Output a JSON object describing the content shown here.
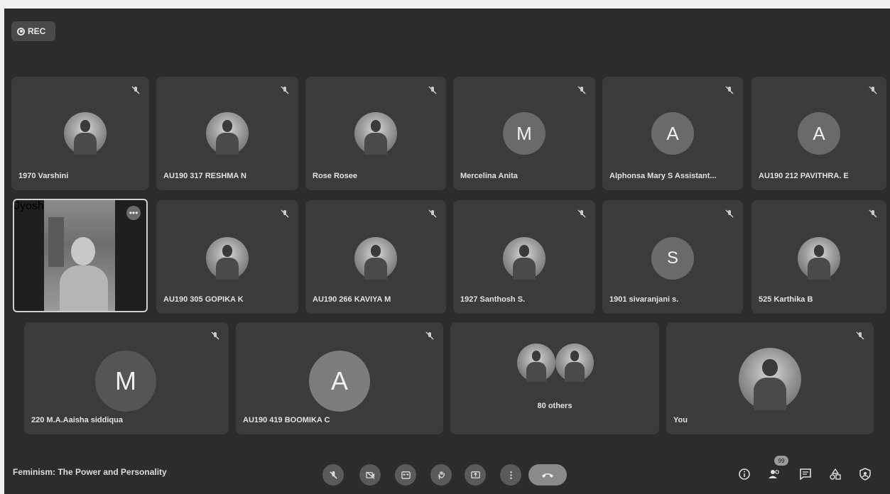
{
  "recording": {
    "label": "REC"
  },
  "participants": [
    {
      "name": "1970 Varshini",
      "avatar": "photo"
    },
    {
      "name": "AU190 317 RESHMA N",
      "avatar": "photo"
    },
    {
      "name": "Rose Rosee",
      "avatar": "photo"
    },
    {
      "name": "Mercelina Anita",
      "avatar": "letter",
      "initial": "M"
    },
    {
      "name": "Alphonsa Mary S Assistant...",
      "avatar": "letter",
      "initial": "A"
    },
    {
      "name": "AU190 212 PAVITHRA. E",
      "avatar": "letter",
      "initial": "A"
    },
    {
      "name": "Jyoshna Vijayan",
      "avatar": "video"
    },
    {
      "name": "AU190 305 GOPIKA K",
      "avatar": "photo"
    },
    {
      "name": "AU190 266 KAVIYA M",
      "avatar": "photo"
    },
    {
      "name": "1927 Santhosh S.",
      "avatar": "photo"
    },
    {
      "name": "1901 sivaranjani s.",
      "avatar": "letter",
      "initial": "S"
    },
    {
      "name": "525 Karthika B",
      "avatar": "photo"
    },
    {
      "name": "220 M.A.Aaisha siddiqua",
      "avatar": "letter",
      "initial": "M"
    },
    {
      "name": "AU190 419 BOOMIKA C",
      "avatar": "letter",
      "initial": "A"
    },
    {
      "name": "You",
      "avatar": "photo"
    }
  ],
  "others": {
    "label": "80 others"
  },
  "meeting": {
    "title": "Feminism: The Power and Personality"
  },
  "people_count": "99",
  "controls": [
    "mic-off-icon",
    "camera-off-icon",
    "captions-icon",
    "raise-hand-icon",
    "present-icon",
    "more-options-icon",
    "leave-call-icon"
  ],
  "right_controls": [
    "info-icon",
    "people-icon",
    "chat-icon",
    "activities-icon",
    "host-controls-icon"
  ]
}
